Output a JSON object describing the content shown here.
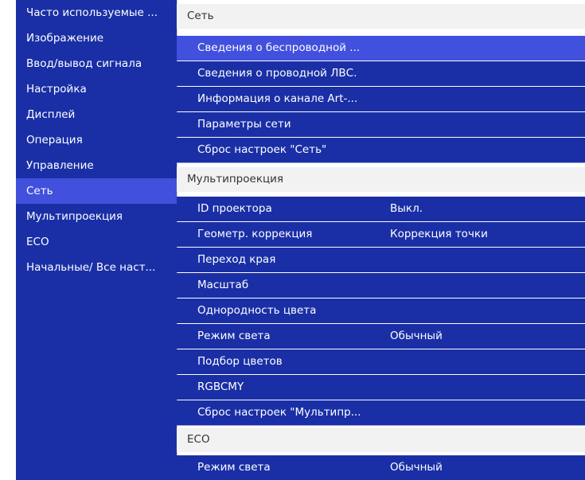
{
  "sidebar": {
    "items": [
      {
        "label": "Часто используемые ..."
      },
      {
        "label": "Изображение"
      },
      {
        "label": "Ввод/вывод сигнала"
      },
      {
        "label": "Настройка"
      },
      {
        "label": "Дисплей"
      },
      {
        "label": "Операция"
      },
      {
        "label": "Управление"
      },
      {
        "label": "Сеть"
      },
      {
        "label": "Мультипроекция"
      },
      {
        "label": "ECO"
      },
      {
        "label": "Начальные/ Все наст..."
      }
    ],
    "active": "Сеть"
  },
  "panel": {
    "sections": [
      {
        "title": "Сеть",
        "rows": [
          {
            "label": "Сведения о беспроводной ...",
            "value": ""
          },
          {
            "label": "Сведения о проводной ЛВС.",
            "value": ""
          },
          {
            "label": "Информация о канале Art-...",
            "value": ""
          },
          {
            "label": "Параметры сети",
            "value": ""
          },
          {
            "label": "Сброс настроек \"Сеть\"",
            "value": ""
          }
        ]
      },
      {
        "title": "Мультипроекция",
        "rows": [
          {
            "label": "ID проектора",
            "value": "Выкл."
          },
          {
            "label": "Геометр. коррекция",
            "value": "Коррекция точки"
          },
          {
            "label": "Переход края",
            "value": ""
          },
          {
            "label": "Масштаб",
            "value": ""
          },
          {
            "label": "Однородность цвета",
            "value": ""
          },
          {
            "label": "Режим света",
            "value": "Обычный"
          },
          {
            "label": "Подбор цветов",
            "value": ""
          },
          {
            "label": "RGBCMY",
            "value": ""
          },
          {
            "label": "Сброс настроек \"Мультипр...",
            "value": ""
          }
        ]
      },
      {
        "title": "ECO",
        "rows": [
          {
            "label": "Режим света",
            "value": "Обычный"
          }
        ]
      }
    ],
    "selected": "Сведения о беспроводной ..."
  },
  "colors": {
    "menu_background": "#1a2fa6",
    "highlight": "#4150dd",
    "section_header": "#f2f2f2"
  }
}
